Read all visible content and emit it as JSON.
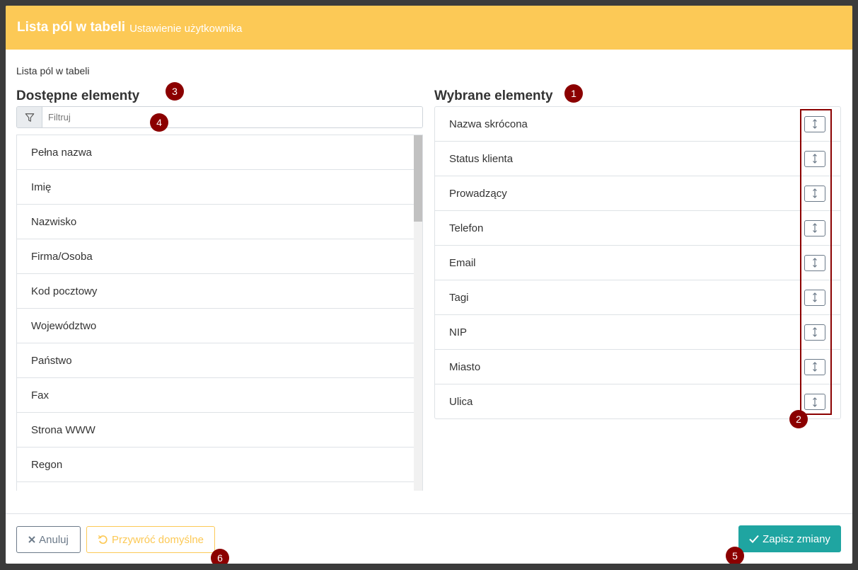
{
  "header": {
    "title": "Lista pól w tabeli",
    "subtitle": "Ustawienie użytkownika"
  },
  "body": {
    "caption": "Lista pól w tabeli",
    "available": {
      "title": "Dostępne elementy",
      "filter_placeholder": "Filtruj",
      "filter_icon": "filter-icon",
      "items": [
        "Pełna nazwa",
        "Imię",
        "Nazwisko",
        "Firma/Osoba",
        "Kod pocztowy",
        "Województwo",
        "Państwo",
        "Fax",
        "Strona WWW",
        "Regon"
      ]
    },
    "selected": {
      "title": "Wybrane elementy",
      "handle_icon": "drag-handle-icon",
      "items": [
        "Nazwa skrócona",
        "Status klienta",
        "Prowadzący",
        "Telefon",
        "Email",
        "Tagi",
        "NIP",
        "Miasto",
        "Ulica"
      ]
    }
  },
  "footer": {
    "cancel_label": "Anuluj",
    "restore_label": "Przywróć domyślne",
    "save_label": "Zapisz zmiany"
  },
  "annotations": [
    "1",
    "2",
    "3",
    "4",
    "5",
    "6"
  ],
  "colors": {
    "header_bg": "#fcc956",
    "save_bg": "#1fa5a1",
    "annotation_badge": "#8b0000",
    "cancel_border": "#6c7a89",
    "restore_border": "#fcc956"
  }
}
